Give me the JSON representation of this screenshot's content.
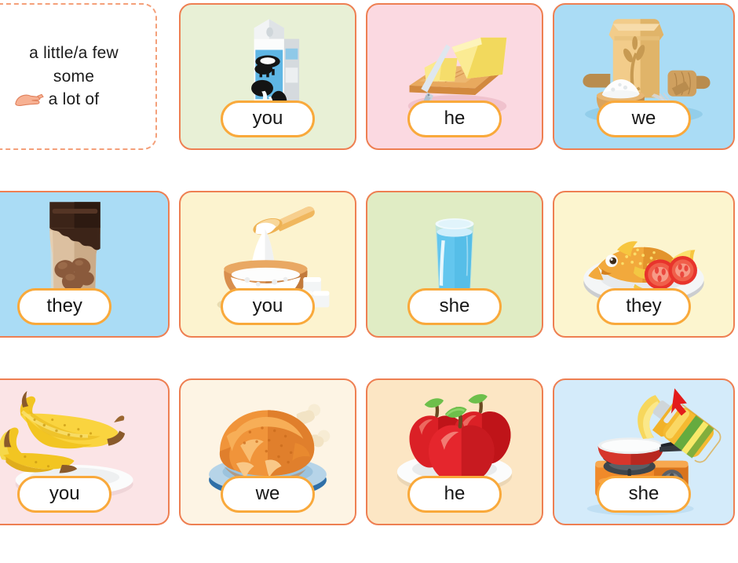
{
  "worksheet": {
    "instruction": {
      "lines": [
        "a little/a few",
        "some",
        "a lot of"
      ],
      "pointer_icon": "pointing-hand-icon",
      "border_color": "#f4a07a"
    },
    "card_border_color": "#ee7f52",
    "pill_border_color": "#f9a93b"
  },
  "cards": [
    {
      "id": "milk",
      "picture": "milk-carton",
      "answer": "you",
      "bg": "#e8f0d6"
    },
    {
      "id": "butter",
      "picture": "butter-on-board",
      "answer": "he",
      "bg": "#fbd9e1"
    },
    {
      "id": "flour",
      "picture": "flour-bag",
      "answer": "we",
      "bg": "#aadcf5"
    },
    {
      "id": "chocolate",
      "picture": "chocolate-bag",
      "answer": "they",
      "bg": "#aadcf5"
    },
    {
      "id": "sugar",
      "picture": "sugar-bowl",
      "answer": "you",
      "bg": "#fcf3cf"
    },
    {
      "id": "water",
      "picture": "glass-of-water",
      "answer": "she",
      "bg": "#e0ecc4"
    },
    {
      "id": "fish",
      "picture": "fried-fish-plate",
      "answer": "they",
      "bg": "#fcf5cf"
    },
    {
      "id": "bananas",
      "picture": "bananas-on-plate",
      "answer": "you",
      "bg": "#fbe4e6"
    },
    {
      "id": "chicken",
      "picture": "roast-chicken-plate",
      "answer": "we",
      "bg": "#fdf4e4"
    },
    {
      "id": "apples",
      "picture": "apples-on-plate",
      "answer": "he",
      "bg": "#fce6c4"
    },
    {
      "id": "oil",
      "picture": "oil-bottle-pan-stove",
      "answer": "she",
      "bg": "#d4ebfa",
      "annotation_icon": "red-arrow-icon"
    }
  ]
}
